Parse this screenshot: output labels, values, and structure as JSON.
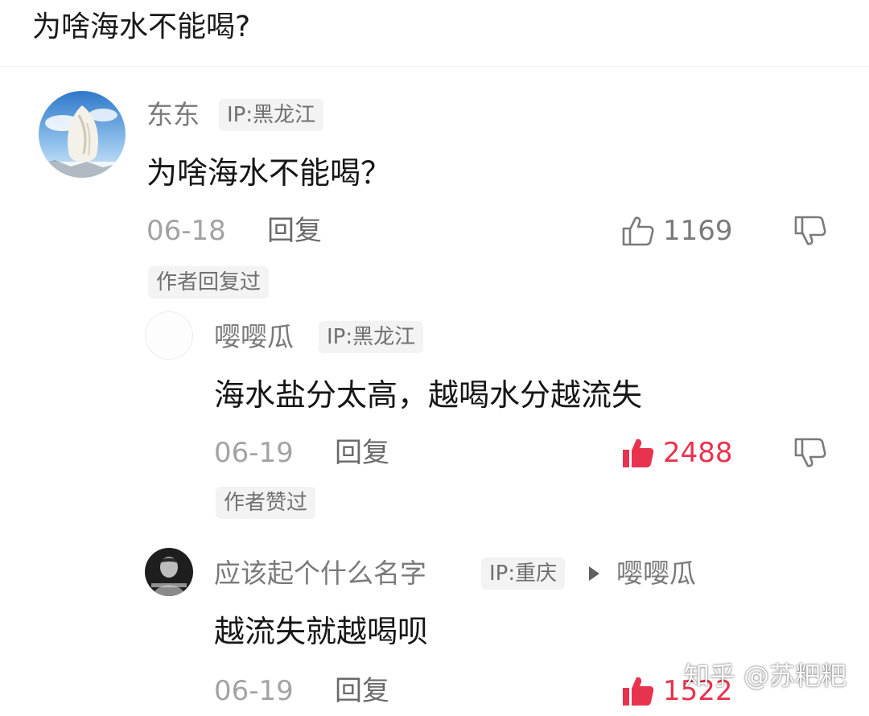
{
  "question": {
    "title": "为啥海水不能喝?"
  },
  "comments": [
    {
      "username": "东东",
      "ip": "IP:黑龙江",
      "content": "为啥海水不能喝？",
      "date": "06-18",
      "reply_label": "回复",
      "likes": "1169",
      "liked": false,
      "badge": "作者回复过",
      "avatar_icon": "snowy-tree-avatar"
    },
    {
      "username": "嘤嘤瓜",
      "ip": "IP:黑龙江",
      "content": "海水盐分太高，越喝水分越流失",
      "date": "06-19",
      "reply_label": "回复",
      "likes": "2488",
      "liked": true,
      "badge": "作者赞过",
      "avatar_icon": "blank-avatar"
    },
    {
      "username": "应该起个什么名字",
      "ip": "IP:重庆",
      "reply_to": "嘤嘤瓜",
      "content": "越流失就越喝呗",
      "date": "06-19",
      "reply_label": "回复",
      "likes": "1522",
      "liked": true,
      "avatar_icon": "portrait-avatar"
    }
  ],
  "watermark": "知乎 @苏粑粑",
  "colors": {
    "liked": "#e8334f",
    "muted": "#a3a3a3",
    "chip_bg": "#f3f3f3"
  }
}
